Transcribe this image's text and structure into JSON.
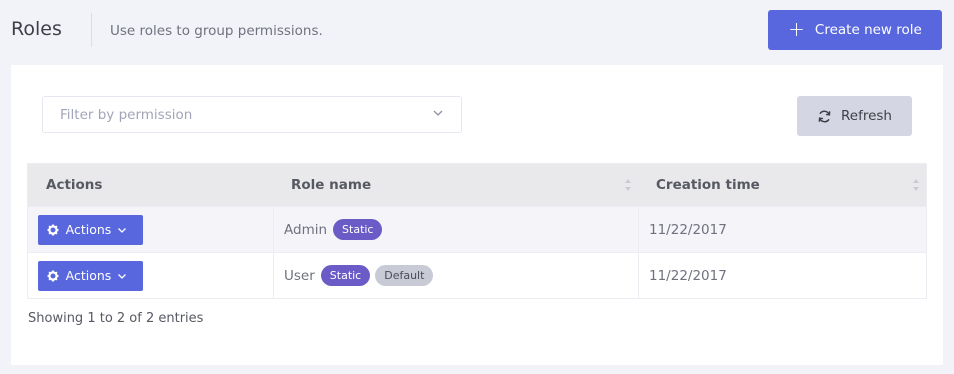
{
  "header": {
    "title": "Roles",
    "description": "Use roles to group permissions.",
    "create_button": "Create new role"
  },
  "toolbar": {
    "filter_placeholder": "Filter by permission",
    "refresh_button": "Refresh"
  },
  "table": {
    "columns": [
      "Actions",
      "Role name",
      "Creation time"
    ],
    "rows": [
      {
        "action": "Actions",
        "role": "Admin",
        "badges": [
          "Static"
        ],
        "created": "11/22/2017"
      },
      {
        "action": "Actions",
        "role": "User",
        "badges": [
          "Static",
          "Default"
        ],
        "created": "11/22/2017"
      }
    ]
  },
  "footer": {
    "info": "Showing 1 to 2 of 2 entries"
  },
  "colors": {
    "primary": "#5867dd",
    "static_badge": "#6a5bc7",
    "default_badge": "#c8cad6",
    "refresh_bg": "#d5d6e3"
  }
}
